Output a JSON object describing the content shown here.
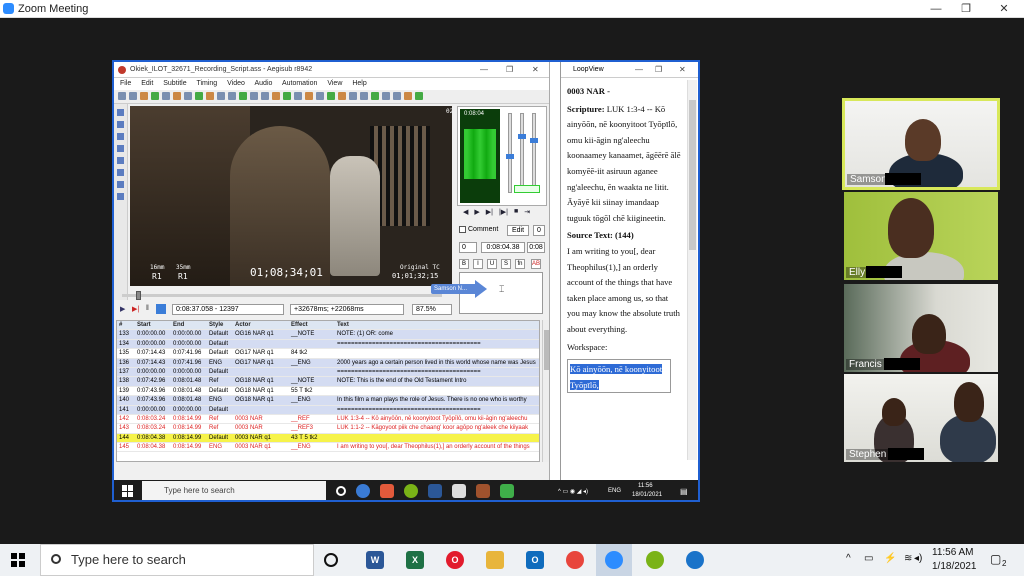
{
  "zoom": {
    "title": "Zoom Meeting",
    "btn_min": "—",
    "btn_max": "❐",
    "btn_close": "✕"
  },
  "aegisub": {
    "title": "Okiek_ILOT_32671_Recording_Script.ass - Aegisub r8942",
    "menu": [
      "File",
      "Edit",
      "Subtitle",
      "Timing",
      "Video",
      "Audio",
      "Automation",
      "View",
      "Help"
    ],
    "video": {
      "timecode": "01;08;34;01",
      "label_16mm_a": "16mm",
      "label_35mm_a": "35mm",
      "label_r1_a": "R1",
      "label_r1_b": "R1",
      "label_orig_tc": "Original TC",
      "label_orig_tc_val": "01;01;32;15",
      "corner": "02"
    },
    "audio_time": "0:08:04",
    "edit": {
      "comment_label": "Comment",
      "edit_btn": "Edit",
      "layer": "0",
      "layer2": "0",
      "start_time": "0:08:04.38",
      "end_partial": "0:08",
      "fmt_b": "B",
      "fmt_i": "I",
      "fmt_u": "U",
      "fmt_s": "S",
      "fmt_fn": "fn",
      "fmt_ab": "AB",
      "speaker_tag": "Samson N..."
    },
    "seek": {
      "pos": "0:08:37.058 - 12397",
      "offset": "+32678ms; +22068ms",
      "zoom": "87.5%"
    },
    "grid_headers": [
      "#",
      "Start",
      "End",
      "Style",
      "Actor",
      "Effect",
      "Text"
    ],
    "rows": [
      {
        "n": "133",
        "s": "0:00:00.00",
        "e": "0:00:00.00",
        "st": "Default",
        "ac": "OG16  NAR  q1",
        "ef": "__NOTE",
        "tx": "NOTE: (1) OR: come",
        "cls": "rnote"
      },
      {
        "n": "134",
        "s": "0:00:00.00",
        "e": "0:00:00.00",
        "st": "Default",
        "ac": "",
        "ef": "",
        "tx": "=========================================",
        "cls": "rnote"
      },
      {
        "n": "135",
        "s": "0:07:14.43",
        "e": "0:07:41.96",
        "st": "Default",
        "ac": "OG17  NAR  q1",
        "ef": "84 tk2",
        "tx": "",
        "cls": "rnarbg"
      },
      {
        "n": "136",
        "s": "0:07:14.43",
        "e": "0:07:41.96",
        "st": "ENG",
        "ac": "OG17  NAR  q1",
        "ef": "__ENG",
        "tx": "2000 years ago a certain person lived in this world whose name was Jesus",
        "cls": "rnote"
      },
      {
        "n": "137",
        "s": "0:00:00.00",
        "e": "0:00:00.00",
        "st": "Default",
        "ac": "",
        "ef": "",
        "tx": "=========================================",
        "cls": "rnote"
      },
      {
        "n": "138",
        "s": "0:07:42.96",
        "e": "0:08:01.48",
        "st": "Ref",
        "ac": "OG18  NAR  q1",
        "ef": "__NOTE",
        "tx": "NOTE: This is the end of the Old Testament Intro",
        "cls": "rnote"
      },
      {
        "n": "139",
        "s": "0:07:43.96",
        "e": "0:08:01.48",
        "st": "Default",
        "ac": "OG18  NAR  q1",
        "ef": "55 T tk2",
        "tx": "",
        "cls": "rnarbg"
      },
      {
        "n": "140",
        "s": "0:07:43.96",
        "e": "0:08:01.48",
        "st": "ENG",
        "ac": "OG18  NAR  q1",
        "ef": "__ENG",
        "tx": "In this film a man plays the role of Jesus. There is no one who is worthy",
        "cls": "rnote"
      },
      {
        "n": "141",
        "s": "0:00:00.00",
        "e": "0:00:00.00",
        "st": "Default",
        "ac": "",
        "ef": "",
        "tx": "=========================================",
        "cls": "rnote"
      },
      {
        "n": "142",
        "s": "0:08:03.24",
        "e": "0:08:14.99",
        "st": "Ref",
        "ac": "0003  NAR",
        "ef": "__REF",
        "tx": "LUK 1:3-4 -- Kō ainyōōn, nē koonyitoot Tyōpīlō, omu kii-āgin ng'aleechu",
        "cls": "rred"
      },
      {
        "n": "143",
        "s": "0:08:03.24",
        "e": "0:08:14.99",
        "st": "Ref",
        "ac": "0003  NAR",
        "ef": "__REF3",
        "tx": "LUK 1:1-2 -- Kāgoyoot piik che chaang' koor agōpo ng'aleek che kiiyaak",
        "cls": "rred"
      },
      {
        "n": "144",
        "s": "0:08:04.38",
        "e": "0:08:14.99",
        "st": "Default",
        "ac": "0003  NAR  q1",
        "ef": "43 T 5 tk2",
        "tx": "",
        "cls": "rsel"
      },
      {
        "n": "145",
        "s": "0:08:04.38",
        "e": "0:08:14.99",
        "st": "ENG",
        "ac": "0003  NAR  q1",
        "ef": "__ENG",
        "tx": "I am writing to you[, dear Theophilus(1),] an orderly account of the things",
        "cls": "rred"
      }
    ]
  },
  "loopview": {
    "title": "LoopView",
    "heading": "0003 NAR -",
    "scripture_label": "Scripture:",
    "scripture_text": "LUK 1:3-4 -- Kō ainyōōn, nē koonyitoot Tyōpīlō, omu kii-āgin ng'aleechu koonaamey kanaamet, āgēērē ālē komyēē-iit asiruun aganee ng'aleechu, ēn waakta ne litit. Āyāyē kii siinay imandaap tuguuk tōgōl chē kiigineetin.",
    "source_label": "Source Text: (144)",
    "source_text": "I am writing to you[, dear Theophilus(1),] an orderly account of the things that have taken place among us, so that you may know the absolute truth about everything.",
    "workspace_label": "Workspace:",
    "workspace_text": "Kō ainyōōn, nē koonyitoot Tyōpīlō,"
  },
  "inner_taskbar": {
    "search": "Type here to search",
    "time": "11:56",
    "date": "18/01/2021",
    "lang": "ENG"
  },
  "participants": [
    {
      "name": "Samson"
    },
    {
      "name": "Elly"
    },
    {
      "name": "Francis"
    },
    {
      "name": "Stephen"
    }
  ],
  "taskbar": {
    "search": "Type here to search",
    "time": "11:56 AM",
    "date": "1/18/2021",
    "notif": "2"
  },
  "colors": {
    "accent": "#2d8cff",
    "speaker_border": "#d8e85a",
    "selected_row": "#f6f34a"
  }
}
